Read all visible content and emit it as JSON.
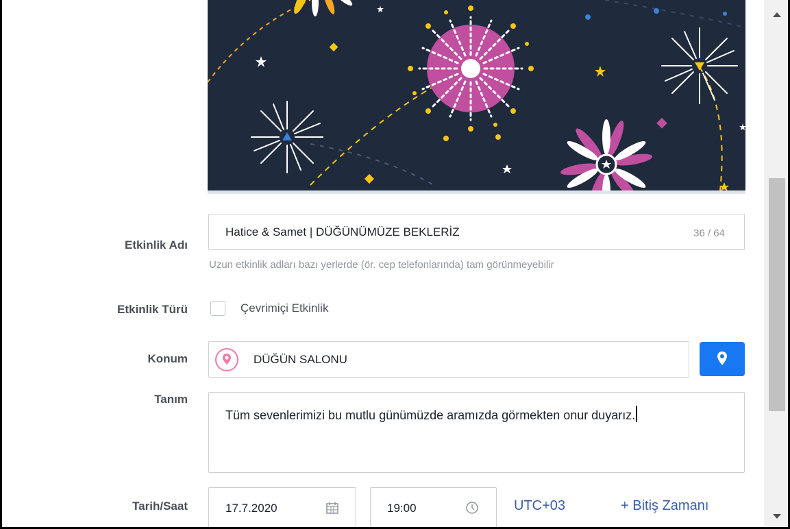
{
  "form": {
    "event_name_label": "Etkinlik Adı",
    "event_name_value": "Hatice & Samet | DÜĞÜNÜMÜZE BEKLERİZ",
    "event_name_counter": "36 / 64",
    "event_name_helper": "Uzun etkinlik adları bazı yerlerde (ör. cep telefonlarında) tam görünmeyebilir",
    "event_type_label": "Etkinlik Türü",
    "online_event_label": "Çevrimiçi Etkinlik",
    "online_event_checked": false,
    "location_label": "Konum",
    "location_value": "DÜĞÜN SALONU",
    "description_label": "Tanım",
    "description_value": "Tüm sevenlerimizi bu mutlu günümüzde aramızda görmekten onur duyarız.",
    "datetime_label": "Tarih/Saat",
    "date_value": "17.7.2020",
    "time_value": "19:00",
    "timezone": "UTC+03",
    "end_time_link": "+ Bitiş Zamanı"
  },
  "icons": {
    "location_pin": "map-pin-icon",
    "map_button": "map-pin-icon",
    "calendar": "calendar-icon",
    "clock": "clock-icon"
  },
  "colors": {
    "cover_background": "#1f2a3c",
    "accent_blue": "#1877f2",
    "link_blue": "#3b5ea8",
    "pin_pink": "#f07aa6",
    "firework_pink": "#c04fa0",
    "firework_yellow": "#f5c518"
  }
}
